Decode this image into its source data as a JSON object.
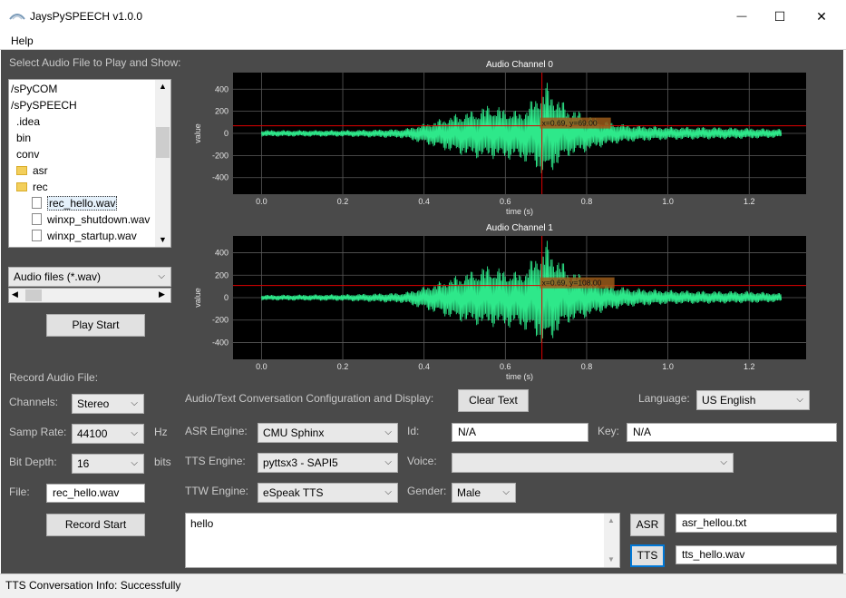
{
  "window": {
    "title": "JaysPySPEECH v1.0.0",
    "minimize_glyph": "—",
    "maximize_glyph": "☐",
    "close_glyph": "✕"
  },
  "menu": {
    "help": "Help"
  },
  "file_panel": {
    "heading": "Select Audio File to Play and Show:",
    "tree": [
      {
        "label": "/sPyCOM",
        "indent": 0,
        "icon": "none"
      },
      {
        "label": "/sPySPEECH",
        "indent": 0,
        "icon": "none"
      },
      {
        "label": ".idea",
        "indent": 1,
        "icon": "none"
      },
      {
        "label": "bin",
        "indent": 1,
        "icon": "none"
      },
      {
        "label": "conv",
        "indent": 1,
        "icon": "none"
      },
      {
        "label": "asr",
        "indent": 1,
        "icon": "folder"
      },
      {
        "label": "rec",
        "indent": 1,
        "icon": "folder"
      },
      {
        "label": "rec_hello.wav",
        "indent": 2,
        "icon": "file",
        "selected": true
      },
      {
        "label": "winxp_shutdown.wav",
        "indent": 2,
        "icon": "file"
      },
      {
        "label": "winxp_startup.wav",
        "indent": 2,
        "icon": "file"
      },
      {
        "label": "",
        "indent": 1,
        "icon": "folder"
      }
    ],
    "filter": "Audio files (*.wav)",
    "play_button": "Play Start"
  },
  "record": {
    "heading": "Record Audio File:",
    "channels_label": "Channels:",
    "channels_value": "Stereo",
    "samp_rate_label": "Samp Rate:",
    "samp_rate_value": "44100",
    "samp_rate_unit": "Hz",
    "bit_depth_label": "Bit Depth:",
    "bit_depth_value": "16",
    "bit_depth_unit": "bits",
    "file_label": "File:",
    "file_value": "rec_hello.wav",
    "record_button": "Record Start"
  },
  "conversation": {
    "heading": "Audio/Text  Conversation Configuration and Display:",
    "clear_button": "Clear Text",
    "language_label": "Language:",
    "language_value": "US English",
    "asr_engine_label": "ASR Engine:",
    "asr_engine_value": "CMU Sphinx",
    "id_label": "Id:",
    "id_value": "N/A",
    "key_label": "Key:",
    "key_value": "N/A",
    "tts_engine_label": "TTS Engine:",
    "tts_engine_value": "pyttsx3 - SAPI5",
    "voice_label": "Voice:",
    "voice_value": "",
    "ttw_engine_label": "TTW Engine:",
    "ttw_engine_value": "eSpeak TTS",
    "gender_label": "Gender:",
    "gender_value": "Male",
    "text_content": "hello",
    "asr_button": "ASR",
    "asr_file": "asr_hellou.txt",
    "tts_button": "TTS",
    "tts_file": "tts_hello.wav"
  },
  "status": {
    "text": "TTS Conversation Info: Successfully"
  },
  "colors": {
    "panel_bg": "#4a4a4a",
    "plot_bg": "#000000",
    "waveform": "#2ee88a",
    "cursor": "#e00000",
    "grid": "#5a5a5a"
  },
  "chart_data": [
    {
      "type": "line",
      "title": "Audio Channel 0",
      "xlabel": "time (s)",
      "ylabel": "value",
      "xlim": [
        -0.07,
        1.34
      ],
      "ylim": [
        -550,
        550
      ],
      "xticks": [
        "0.0",
        "0.2",
        "0.4",
        "0.6",
        "0.8",
        "1.0",
        "1.2"
      ],
      "yticks": [
        "400",
        "200",
        "0",
        "-200",
        "-400"
      ],
      "grid": true,
      "cursor": {
        "x": 0.69,
        "y": 69.0,
        "label": "x=0.69, y=69.00"
      },
      "envelope": {
        "t": [
          0.0,
          0.2,
          0.35,
          0.42,
          0.48,
          0.53,
          0.56,
          0.6,
          0.64,
          0.67,
          0.7,
          0.72,
          0.75,
          0.8,
          0.85,
          0.9,
          1.0,
          1.1,
          1.2,
          1.28
        ],
        "upper": [
          30,
          30,
          40,
          110,
          180,
          220,
          270,
          230,
          200,
          330,
          470,
          380,
          260,
          170,
          110,
          80,
          60,
          60,
          50,
          40
        ],
        "lower": [
          -30,
          -30,
          -45,
          -120,
          -190,
          -230,
          -230,
          -240,
          -250,
          -310,
          -420,
          -330,
          -220,
          -170,
          -110,
          -80,
          -60,
          -55,
          -50,
          -40
        ]
      }
    },
    {
      "type": "line",
      "title": "Audio Channel 1",
      "xlabel": "time (s)",
      "ylabel": "value",
      "xlim": [
        -0.07,
        1.34
      ],
      "ylim": [
        -550,
        550
      ],
      "xticks": [
        "0.0",
        "0.2",
        "0.4",
        "0.6",
        "0.8",
        "1.0",
        "1.2"
      ],
      "yticks": [
        "400",
        "200",
        "0",
        "-200",
        "-400"
      ],
      "grid": true,
      "cursor": {
        "x": 0.69,
        "y": 108.0,
        "label": "x=0.69, y=108.00"
      },
      "envelope": {
        "t": [
          0.0,
          0.2,
          0.35,
          0.42,
          0.48,
          0.53,
          0.56,
          0.6,
          0.64,
          0.67,
          0.7,
          0.72,
          0.75,
          0.8,
          0.85,
          0.9,
          1.0,
          1.1,
          1.2,
          1.28
        ],
        "upper": [
          25,
          30,
          45,
          120,
          200,
          260,
          300,
          250,
          230,
          370,
          520,
          420,
          280,
          180,
          120,
          90,
          70,
          60,
          60,
          40
        ],
        "lower": [
          -25,
          -30,
          -50,
          -130,
          -210,
          -250,
          -260,
          -270,
          -280,
          -350,
          -460,
          -360,
          -240,
          -180,
          -120,
          -85,
          -60,
          -55,
          -50,
          -40
        ]
      }
    }
  ]
}
